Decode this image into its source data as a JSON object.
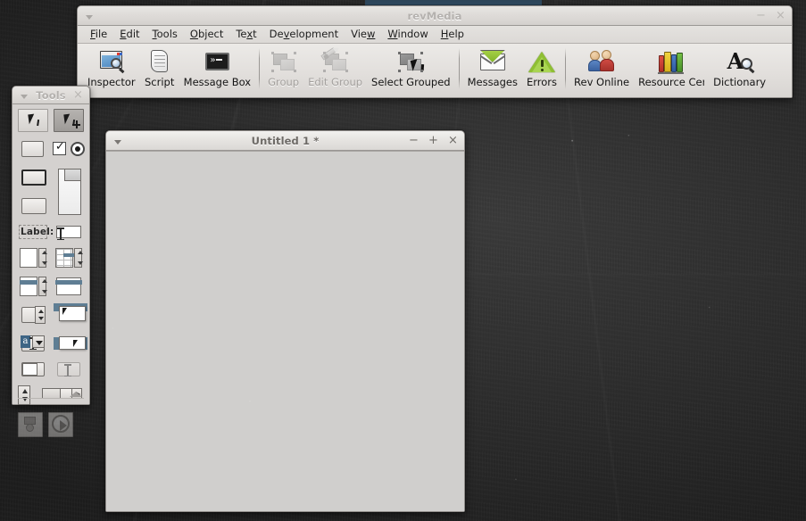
{
  "desktop": {
    "background_color": "#2f2f2f",
    "bg_window_sliver_color": "#33506a"
  },
  "main_window": {
    "title": "revMedia",
    "active": false,
    "collapse_icon": "chevron-down-icon",
    "controls": [
      {
        "name": "minimize",
        "glyph": "−"
      },
      {
        "name": "close",
        "glyph": "×"
      }
    ],
    "menubar": [
      {
        "label": "File",
        "mnemonic": "F"
      },
      {
        "label": "Edit",
        "mnemonic": "E"
      },
      {
        "label": "Tools",
        "mnemonic": "T"
      },
      {
        "label": "Object",
        "mnemonic": "O"
      },
      {
        "label": "Text",
        "mnemonic": "x"
      },
      {
        "label": "Development",
        "mnemonic": "v"
      },
      {
        "label": "View",
        "mnemonic": "w"
      },
      {
        "label": "Window",
        "mnemonic": "W"
      },
      {
        "label": "Help",
        "mnemonic": "H"
      }
    ],
    "toolbar": [
      {
        "label": "Inspector",
        "icon": "inspector-icon",
        "disabled": false
      },
      {
        "label": "Script",
        "icon": "script-icon",
        "disabled": false
      },
      {
        "label": "Message Box",
        "icon": "message-box-icon",
        "disabled": false
      },
      {
        "separator": true
      },
      {
        "label": "Group",
        "icon": "group-icon",
        "disabled": true
      },
      {
        "label": "Edit Group",
        "icon": "edit-group-icon",
        "disabled": true
      },
      {
        "label": "Select Grouped",
        "icon": "select-grouped-icon",
        "disabled": false
      },
      {
        "separator": true
      },
      {
        "label": "Messages",
        "icon": "messages-icon",
        "disabled": false
      },
      {
        "label": "Errors",
        "icon": "errors-icon",
        "disabled": false
      },
      {
        "separator": true
      },
      {
        "label": "Rev Online",
        "icon": "rev-online-icon",
        "disabled": false
      },
      {
        "label": "Resource Center",
        "icon": "resource-center-icon",
        "disabled": false,
        "clipped": true
      },
      {
        "label": "Dictionary",
        "icon": "dictionary-icon",
        "disabled": false
      }
    ]
  },
  "tools_palette": {
    "title": "Tools",
    "active": false,
    "collapse_icon": "chevron-down-icon",
    "close_icon": "close-icon",
    "close_glyph": "×",
    "label_tool_text": "Label:",
    "menu_button_text": "a",
    "resize_arrow_icon": "triangle-up-icon",
    "tools": [
      {
        "name": "pointer-tool",
        "selected": false
      },
      {
        "name": "edit-pointer-tool",
        "selected": true
      },
      {
        "name": "button-tool",
        "selected": false
      },
      {
        "name": "checkbox-tool",
        "selected": false
      },
      {
        "name": "radio-button-tool",
        "selected": false
      },
      {
        "name": "default-button-tool",
        "selected": false
      },
      {
        "name": "card-tool",
        "selected": false
      },
      {
        "name": "rounded-button-tool",
        "selected": false
      },
      {
        "name": "label-field-tool",
        "selected": false
      },
      {
        "name": "text-field-tool",
        "selected": false
      },
      {
        "name": "scrolling-field-tool",
        "selected": false
      },
      {
        "name": "table-field-tool",
        "selected": false
      },
      {
        "name": "list-field-tool",
        "selected": false
      },
      {
        "name": "header-field-tool",
        "selected": false
      },
      {
        "name": "spinner-field-tool",
        "selected": false
      },
      {
        "name": "popup-window-tool",
        "selected": false
      },
      {
        "name": "option-menu-tool",
        "selected": false
      },
      {
        "name": "palette-window-tool",
        "selected": false
      },
      {
        "name": "progress-bar-tool",
        "selected": false
      },
      {
        "name": "group-box-tool",
        "selected": false
      },
      {
        "name": "vertical-spinner-tool",
        "selected": false
      },
      {
        "name": "scrollbar-tool",
        "selected": false
      },
      {
        "name": "media-object-tool",
        "selected": false
      },
      {
        "name": "player-tool",
        "selected": false
      }
    ]
  },
  "stack_window": {
    "title": "Untitled 1 *",
    "active": true,
    "collapse_icon": "chevron-down-icon",
    "canvas_color": "#d0cfcd",
    "controls": [
      {
        "name": "minimize",
        "glyph": "−"
      },
      {
        "name": "maximize",
        "glyph": "+"
      },
      {
        "name": "close",
        "glyph": "×"
      }
    ]
  }
}
